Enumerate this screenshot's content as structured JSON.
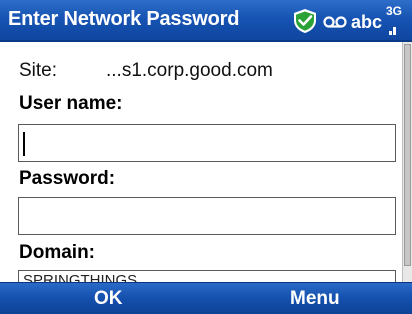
{
  "title_bar": {
    "title": "Enter Network Password",
    "status_icons": [
      "shield-check-icon",
      "voicemail-icon",
      "input-mode-abc",
      "3g-signal-icon"
    ],
    "input_mode": "abc",
    "network": "3G",
    "accent_color": "#1754b3"
  },
  "form": {
    "site_label": "Site:",
    "site_value": "...s1.corp.good.com",
    "username_label": "User name:",
    "username_value": "",
    "password_label": "Password:",
    "password_value": "",
    "domain_label": "Domain:",
    "domain_value": "SPRINGTHINGS"
  },
  "softkeys": {
    "left": "OK",
    "right": "Menu"
  }
}
